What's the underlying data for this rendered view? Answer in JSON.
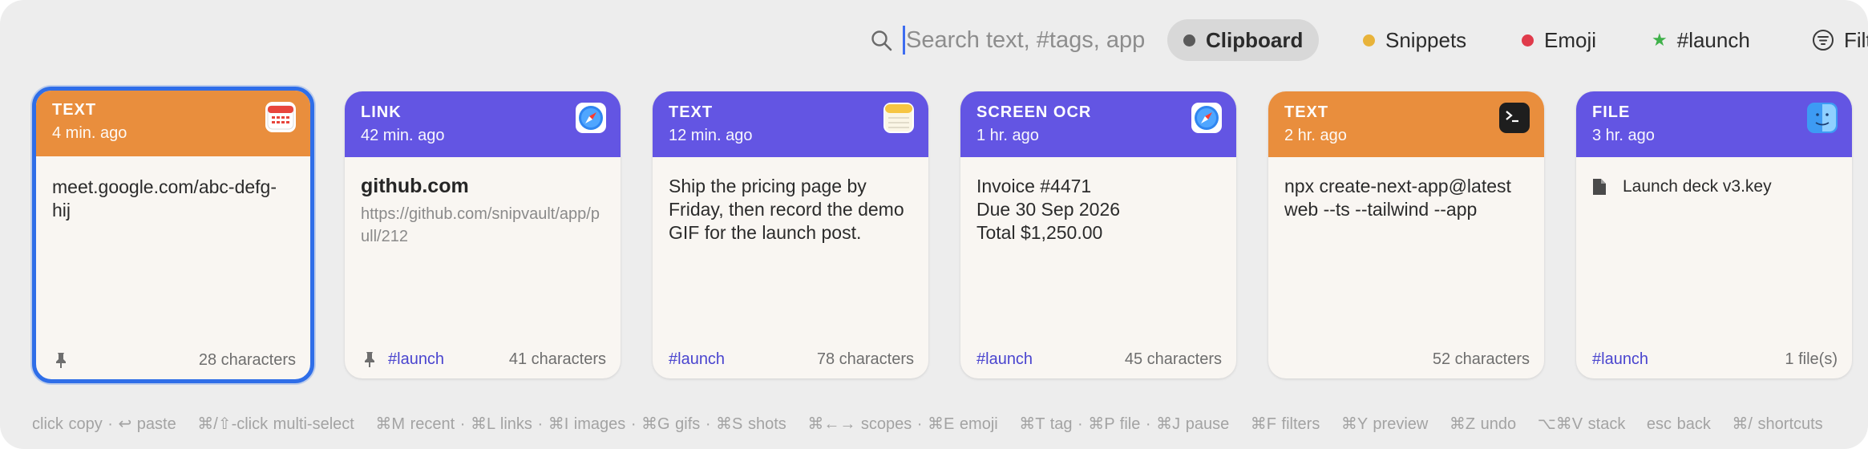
{
  "search": {
    "placeholder": "Search text, #tags, app"
  },
  "scopes": [
    {
      "label": "Clipboard",
      "color": "#5a5a5a",
      "active": true
    },
    {
      "label": "Snippets",
      "color": "#e8b33a"
    },
    {
      "label": "Emoji",
      "color": "#e03b4b"
    },
    {
      "label": "#launch",
      "icon": "star-icon",
      "color": "#3fb14a"
    },
    {
      "label": "Filt",
      "icon": "filter-icon"
    }
  ],
  "colors": {
    "orange": "#e98e3d",
    "purple": "#6355e3",
    "selection": "#2f6ee8",
    "tag": "#4a45cf"
  },
  "cards": [
    {
      "type": "TEXT",
      "time": "4 min. ago",
      "app_icon": "calendar-icon",
      "body": "meet.google.com/abc-defg-hij",
      "pinned": true,
      "tag": "",
      "chars": "28 characters"
    },
    {
      "type": "LINK",
      "time": "42 min. ago",
      "app_icon": "safari-icon",
      "title": "github.com",
      "url": "https://github.com/snipvault/app/pull/212",
      "pinned": true,
      "tag": "#launch",
      "chars": "41 characters"
    },
    {
      "type": "TEXT",
      "time": "12 min. ago",
      "app_icon": "notes-icon",
      "body": "Ship the pricing page by Friday, then record the demo GIF for the launch post.",
      "tag": "#launch",
      "chars": "78 characters"
    },
    {
      "type": "SCREEN OCR",
      "time": "1 hr. ago",
      "app_icon": "safari-icon",
      "lines": [
        "Invoice #4471",
        "Due 30 Sep 2026",
        "Total $1,250.00"
      ],
      "tag": "#launch",
      "chars": "45 characters"
    },
    {
      "type": "TEXT",
      "time": "2 hr. ago",
      "app_icon": "terminal-icon",
      "body": "npx create-next-app@latest web --ts --tailwind --app",
      "tag": "",
      "chars": "52 characters"
    },
    {
      "type": "FILE",
      "time": "3 hr. ago",
      "app_icon": "finder-icon",
      "file_name": "Launch deck v3.key",
      "tag": "#launch",
      "chars": "1 file(s)"
    }
  ],
  "shortcuts": [
    "click copy · ↩ paste",
    "⌘/⇧-click multi-select",
    "⌘M recent · ⌘L links · ⌘I images · ⌘G gifs · ⌘S shots",
    "⌘←→ scopes · ⌘E emoji",
    "⌘T tag · ⌘P file · ⌘J pause",
    "⌘F filters",
    "⌘Y preview",
    "⌘Z undo",
    "⌥⌘V stack",
    "esc back",
    "⌘/ shortcuts"
  ]
}
